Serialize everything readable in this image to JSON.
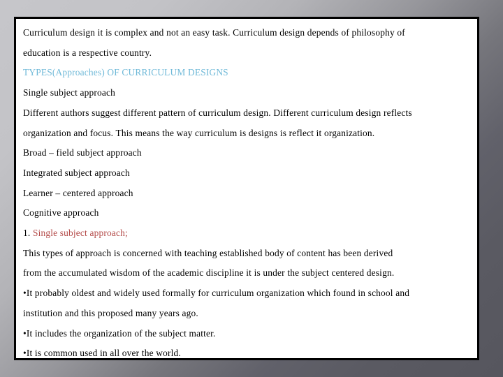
{
  "slide": {
    "background_gradient_from": "#c6c6ca",
    "background_gradient_to": "#56565e",
    "box_background": "#ffffff",
    "box_border_color": "#000000",
    "accent_blue": "#6fb9d8",
    "accent_red": "#b34a48",
    "body_text_color": "#000000"
  },
  "body": {
    "lines": [
      {
        "id": "intro-line-1",
        "text": "Curriculum design it is complex and not an easy task. Curriculum design depends of philosophy of",
        "color": "body"
      },
      {
        "id": "intro-line-2",
        "text": "education is a respective country.",
        "color": "body"
      },
      {
        "id": "heading-types",
        "text": "TYPES(Approaches) OF CURRICULUM DESIGNS",
        "color": "blue"
      },
      {
        "id": "list-single-subject",
        "text": "Single subject approach",
        "color": "body"
      },
      {
        "id": "para-authors-line-1",
        "text": "Different authors suggest different pattern of curriculum design. Different curriculum design reflects",
        "color": "body"
      },
      {
        "id": "para-authors-line-2",
        "text": "organization and focus. This means the way curriculum is designs is reflect it organization.",
        "color": "body"
      },
      {
        "id": "list-broad-field",
        "text": "Broad – field subject approach",
        "color": "body"
      },
      {
        "id": "list-integrated",
        "text": "Integrated subject approach",
        "color": "body"
      },
      {
        "id": "list-learner-centered",
        "text": "Learner – centered approach",
        "color": "body"
      },
      {
        "id": "list-cognitive",
        "text": "Cognitive approach",
        "color": "body"
      },
      {
        "id": "numbered-single-subject",
        "text": "1. Single subject approach;",
        "color": "mixed-red",
        "prefix": "1. ",
        "emphasis": "Single subject approach",
        "suffix": ";"
      },
      {
        "id": "para-types-line-1",
        "text": "This types of approach is concerned with teaching established body of content has been derived",
        "color": "body"
      },
      {
        "id": "para-types-line-2",
        "text": "from the accumulated wisdom of the academic discipline it is under the subject centered design.",
        "color": "body"
      },
      {
        "id": "bullet-oldest-line-1",
        "text": "•It probably oldest and widely used formally for curriculum organization which found in school and",
        "color": "body"
      },
      {
        "id": "bullet-oldest-line-2",
        "text": "institution and this proposed many years ago.",
        "color": "body"
      },
      {
        "id": "bullet-includes",
        "text": "•It includes the organization of the subject matter.",
        "color": "body"
      },
      {
        "id": "bullet-common",
        "text": "•It is common used in all over the world.",
        "color": "body"
      }
    ]
  }
}
